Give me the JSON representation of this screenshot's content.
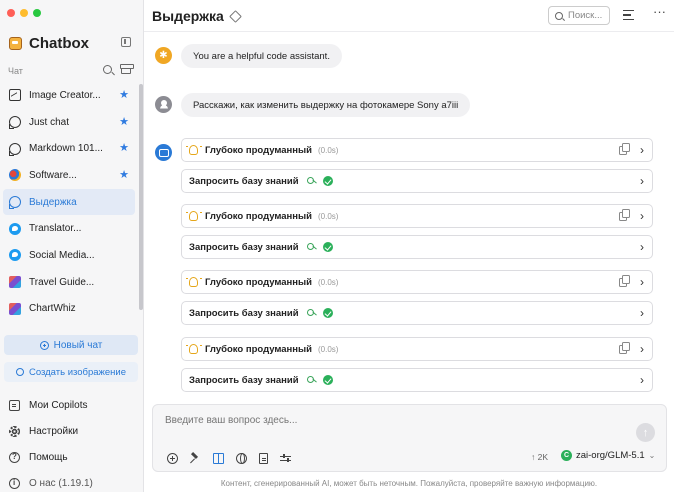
{
  "app": {
    "name": "Chatbox"
  },
  "colors": {
    "accent": "#2a7ad6",
    "traffic_red": "#ff5f57",
    "traffic_yellow": "#febc2e",
    "traffic_green": "#28c840",
    "star": "#2f7be0",
    "success": "#2bb05a"
  },
  "sidebar": {
    "section_label": "Чат",
    "chats": [
      {
        "label": "Image Creator...",
        "icon": "image-icon",
        "starred": true,
        "active": false
      },
      {
        "label": "Just chat",
        "icon": "chat-bubble-icon",
        "starred": true,
        "active": false
      },
      {
        "label": "Markdown 101...",
        "icon": "chat-bubble-icon",
        "starred": true,
        "active": false
      },
      {
        "label": "Software...",
        "icon": "software-dev-icon",
        "starred": true,
        "active": false
      },
      {
        "label": "Выдержка",
        "icon": "chat-bubble-icon",
        "starred": false,
        "active": true
      },
      {
        "label": "Translator...",
        "icon": "twitter-icon",
        "starred": false,
        "active": false
      },
      {
        "label": "Social Media...",
        "icon": "twitter-icon",
        "starred": false,
        "active": false
      },
      {
        "label": "Travel Guide...",
        "icon": "travel-guide-icon",
        "starred": false,
        "active": false
      },
      {
        "label": "ChartWhiz",
        "icon": "chartwhiz-icon",
        "starred": false,
        "active": false
      }
    ],
    "new_chat_label": "Новый чат",
    "new_image_label": "Создать изображение",
    "bottom": {
      "copilots_label": "Мои Copilots",
      "settings_label": "Настройки",
      "help_label": "Помощь",
      "about_label": "О нас (1.19.1)"
    }
  },
  "header": {
    "title": "Выдержка",
    "search_placeholder": "Поиск..."
  },
  "messages": {
    "system_text": "You are a helpful code assistant.",
    "user_text": "Расскажи, как изменить выдержку на фотокамере Sony a7iii",
    "blocks": [
      {
        "thinking_label": "Глубоко продуманный",
        "thinking_duration": "(0.0s)",
        "kb_label": "Запросить базу знаний"
      },
      {
        "thinking_label": "Глубоко продуманный",
        "thinking_duration": "(0.0s)",
        "kb_label": "Запросить базу знаний"
      },
      {
        "thinking_label": "Глубоко продуманный",
        "thinking_duration": "(0.0s)",
        "kb_label": "Запросить базу знаний"
      },
      {
        "thinking_label": "Глубоко продуманный",
        "thinking_duration": "(0.0s)",
        "kb_label": "Запросить базу знаний"
      }
    ]
  },
  "composer": {
    "placeholder": "Введите ваш вопрос здесь...",
    "token_count": "↑ 2K",
    "model_name": "zai-org/GLM-5.1",
    "model_badge": "C"
  },
  "footer_note": "Контент, сгенерированный AI, может быть неточным. Пожалуйста, проверяйте важную информацию."
}
